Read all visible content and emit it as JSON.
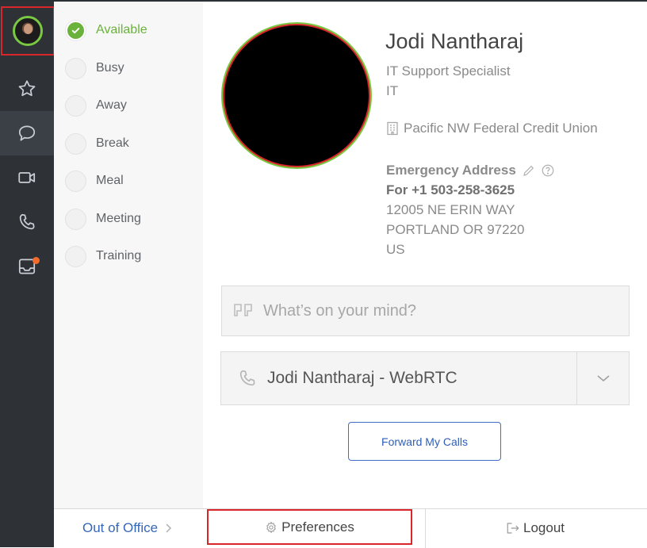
{
  "rail": {
    "items": [
      {
        "icon": "star-icon"
      },
      {
        "icon": "chat-icon",
        "active": true
      },
      {
        "icon": "video-icon"
      },
      {
        "icon": "phone-icon"
      },
      {
        "icon": "inbox-icon",
        "badge": true
      }
    ],
    "badge_color": "#f26b2a"
  },
  "statuses": [
    {
      "label": "Available",
      "selected": true
    },
    {
      "label": "Busy"
    },
    {
      "label": "Away"
    },
    {
      "label": "Break"
    },
    {
      "label": "Meal"
    },
    {
      "label": "Meeting"
    },
    {
      "label": "Training"
    }
  ],
  "profile": {
    "name": "Jodi Nantharaj",
    "title": "IT Support Specialist",
    "department": "IT",
    "company": "Pacific NW Federal Credit Union",
    "emergency": {
      "heading": "Emergency Address",
      "for_line": "For +1 503-258-3625",
      "street": "12005 NE ERIN WAY",
      "city": "PORTLAND OR 97220",
      "country": "US"
    }
  },
  "status_input": {
    "placeholder": "What’s on your mind?"
  },
  "device": {
    "selected": "Jodi Nantharaj - WebRTC"
  },
  "forward_button": "Forward My Calls",
  "footer": {
    "out_of_office": "Out of Office",
    "preferences": "Preferences",
    "logout": "Logout"
  },
  "colors": {
    "accent_green": "#6ab23c",
    "link_blue": "#3467b8",
    "highlight_red": "#d9262b",
    "rail_bg": "#2e3237"
  }
}
